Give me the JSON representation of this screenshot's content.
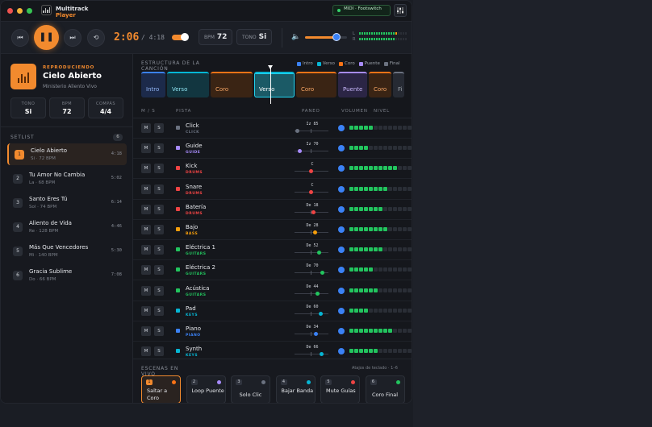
{
  "titlebar": {
    "app_name_line1": "Multitrack",
    "app_name_line2": "Player",
    "midi_status": "MIDI · Footswitch",
    "mixer_icon": "sliders-icon"
  },
  "transport": {
    "time_current": "2:06",
    "time_total": "/ 4:18",
    "loop_toggle_on": true,
    "bpm_label": "BPM",
    "bpm_value": "72",
    "key_label": "TONO",
    "key_value": "Si",
    "master_volume": 0.75,
    "meter_labels": [
      "L",
      "R"
    ]
  },
  "now_playing": {
    "label": "REPRODUCIENDO",
    "title": "Cielo Abierto",
    "artist": "Ministerio Aliento Vivo",
    "stats": [
      {
        "label": "TONO",
        "value": "Si"
      },
      {
        "label": "BPM",
        "value": "72"
      },
      {
        "label": "COMPÁS",
        "value": "4/4"
      }
    ]
  },
  "setlist": {
    "title": "SETLIST",
    "count": "6",
    "songs": [
      {
        "num": "1",
        "title": "Cielo Abierto",
        "meta": "Si · 72 BPM",
        "duration": "4:18",
        "active": true
      },
      {
        "num": "2",
        "title": "Tu Amor No Cambia",
        "meta": "La · 68 BPM",
        "duration": "5:02",
        "active": false
      },
      {
        "num": "3",
        "title": "Santo Eres Tú",
        "meta": "Sol · 74 BPM",
        "duration": "6:14",
        "active": false
      },
      {
        "num": "4",
        "title": "Aliento de Vida",
        "meta": "Re · 128 BPM",
        "duration": "4:46",
        "active": false
      },
      {
        "num": "5",
        "title": "Más Que Vencedores",
        "meta": "Mi · 140 BPM",
        "duration": "5:30",
        "active": false
      },
      {
        "num": "6",
        "title": "Gracia Sublime",
        "meta": "Do · 66 BPM",
        "duration": "7:08",
        "active": false
      }
    ]
  },
  "structure": {
    "title": "ESTRUCTURA DE LA CANCIÓN",
    "legend": [
      {
        "label": "Intro",
        "color": "#3b82f6"
      },
      {
        "label": "Verso",
        "color": "#06b6d4"
      },
      {
        "label": "Coro",
        "color": "#f97316"
      },
      {
        "label": "Puente",
        "color": "#a78bfa"
      },
      {
        "label": "Final",
        "color": "#6b7280"
      }
    ],
    "sections": [
      {
        "label": "Intro",
        "type": "intro",
        "active": false
      },
      {
        "label": "Verso",
        "type": "verso",
        "active": false
      },
      {
        "label": "Coro",
        "type": "coro",
        "active": false
      },
      {
        "label": "Verso",
        "type": "verso",
        "active": true
      },
      {
        "label": "Coro",
        "type": "coro",
        "active": false
      },
      {
        "label": "Puente",
        "type": "puente",
        "active": false
      },
      {
        "label": "Coro",
        "type": "coro",
        "active": false
      },
      {
        "label": "Fi",
        "type": "final",
        "active": false
      }
    ]
  },
  "tracks_header": {
    "ms": "M / S",
    "track": "PISTA",
    "pan": "PANEO",
    "volume": "VOLUMEN",
    "level": "NIVEL"
  },
  "tracks": [
    {
      "name": "Click",
      "group": "CLICK",
      "color": "#6b7280",
      "pan_label": "Iz 85",
      "pan": -0.85,
      "level": 5,
      "mute": "M",
      "solo": "S"
    },
    {
      "name": "Guide",
      "group": "GUIDE",
      "color": "#a78bfa",
      "pan_label": "Iz 70",
      "pan": -0.7,
      "level": 4,
      "mute": "M",
      "solo": "S"
    },
    {
      "name": "Kick",
      "group": "DRUMS",
      "color": "#ef4444",
      "pan_label": "C",
      "pan": 0,
      "level": 10,
      "mute": "M",
      "solo": "S"
    },
    {
      "name": "Snare",
      "group": "DRUMS",
      "color": "#ef4444",
      "pan_label": "C",
      "pan": 0,
      "level": 8,
      "mute": "M",
      "solo": "S"
    },
    {
      "name": "Batería",
      "group": "DRUMS",
      "color": "#ef4444",
      "pan_label": "De 18",
      "pan": 0.18,
      "level": 7,
      "mute": "M",
      "solo": "S"
    },
    {
      "name": "Bajo",
      "group": "BASS",
      "color": "#f59e0b",
      "pan_label": "De 28",
      "pan": 0.28,
      "level": 8,
      "mute": "M",
      "solo": "S"
    },
    {
      "name": "Eléctrica 1",
      "group": "GUITARS",
      "color": "#22c55e",
      "pan_label": "De 52",
      "pan": 0.52,
      "level": 7,
      "mute": "M",
      "solo": "S"
    },
    {
      "name": "Eléctrica 2",
      "group": "GUITARS",
      "color": "#22c55e",
      "pan_label": "De 70",
      "pan": 0.7,
      "level": 5,
      "mute": "M",
      "solo": "S"
    },
    {
      "name": "Acústica",
      "group": "GUITARS",
      "color": "#22c55e",
      "pan_label": "De 44",
      "pan": 0.44,
      "level": 6,
      "mute": "M",
      "solo": "S"
    },
    {
      "name": "Pad",
      "group": "KEYS",
      "color": "#06b6d4",
      "pan_label": "De 60",
      "pan": 0.6,
      "level": 4,
      "mute": "M",
      "solo": "S"
    },
    {
      "name": "Piano",
      "group": "PIANO",
      "color": "#3b82f6",
      "pan_label": "De 34",
      "pan": 0.34,
      "level": 9,
      "mute": "M",
      "solo": "S"
    },
    {
      "name": "Synth",
      "group": "KEYS",
      "color": "#06b6d4",
      "pan_label": "De 66",
      "pan": 0.66,
      "level": 6,
      "mute": "M",
      "solo": "S"
    }
  ],
  "scenes": {
    "title": "ESCENAS EN VIVO",
    "shortcuts": "Atajos de teclado · 1–6",
    "items": [
      {
        "num": "1",
        "label": "Saltar a Coro",
        "color": "#f97316",
        "active": true
      },
      {
        "num": "2",
        "label": "Loop Puente",
        "color": "#a78bfa",
        "active": false
      },
      {
        "num": "3",
        "label": "Solo Clic",
        "color": "#6b7280",
        "active": false
      },
      {
        "num": "4",
        "label": "Bajar Banda",
        "color": "#06b6d4",
        "active": false
      },
      {
        "num": "5",
        "label": "Mute Guías",
        "color": "#ef4444",
        "active": false
      },
      {
        "num": "6",
        "label": "Coro Final",
        "color": "#22c55e",
        "active": false
      }
    ]
  }
}
